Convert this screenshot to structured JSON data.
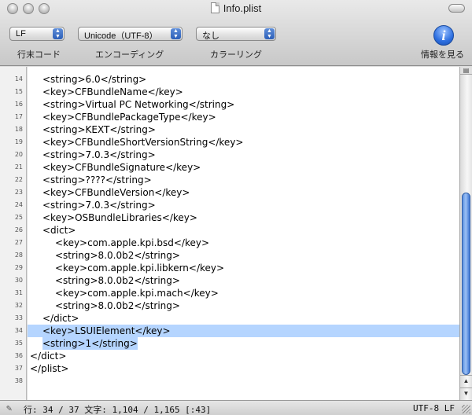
{
  "window": {
    "title": "Info.plist"
  },
  "toolbar": {
    "line_ending": {
      "value": "LF",
      "label": "行末コード"
    },
    "encoding": {
      "value": "Unicode（UTF-8）",
      "label": "エンコーディング"
    },
    "coloring": {
      "value": "なし",
      "label": "カラーリング"
    },
    "info": {
      "label": "情報を見る",
      "icon": "info-icon"
    }
  },
  "editor": {
    "lines": [
      {
        "n": "14",
        "indent": 1,
        "text": "<string>6.0</string>"
      },
      {
        "n": "15",
        "indent": 1,
        "text": "<key>CFBundleName</key>"
      },
      {
        "n": "16",
        "indent": 1,
        "text": "<string>Virtual PC Networking</string>"
      },
      {
        "n": "17",
        "indent": 1,
        "text": "<key>CFBundlePackageType</key>"
      },
      {
        "n": "18",
        "indent": 1,
        "text": "<string>KEXT</string>"
      },
      {
        "n": "19",
        "indent": 1,
        "text": "<key>CFBundleShortVersionString</key>"
      },
      {
        "n": "20",
        "indent": 1,
        "text": "<string>7.0.3</string>"
      },
      {
        "n": "21",
        "indent": 1,
        "text": "<key>CFBundleSignature</key>"
      },
      {
        "n": "22",
        "indent": 1,
        "text": "<string>????</string>"
      },
      {
        "n": "23",
        "indent": 1,
        "text": "<key>CFBundleVersion</key>"
      },
      {
        "n": "24",
        "indent": 1,
        "text": "<string>7.0.3</string>"
      },
      {
        "n": "25",
        "indent": 1,
        "text": "<key>OSBundleLibraries</key>"
      },
      {
        "n": "26",
        "indent": 1,
        "text": "<dict>"
      },
      {
        "n": "27",
        "indent": 2,
        "text": "<key>com.apple.kpi.bsd</key>"
      },
      {
        "n": "28",
        "indent": 2,
        "text": "<string>8.0.0b2</string>"
      },
      {
        "n": "29",
        "indent": 2,
        "text": "<key>com.apple.kpi.libkern</key>"
      },
      {
        "n": "30",
        "indent": 2,
        "text": "<string>8.0.0b2</string>"
      },
      {
        "n": "31",
        "indent": 2,
        "text": "<key>com.apple.kpi.mach</key>"
      },
      {
        "n": "32",
        "indent": 2,
        "text": "<string>8.0.0b2</string>"
      },
      {
        "n": "33",
        "indent": 1,
        "text": "</dict>"
      },
      {
        "n": "34",
        "indent": 1,
        "text": "<key>LSUIElement</key>",
        "selected": "full"
      },
      {
        "n": "35",
        "indent": 1,
        "text": "<string>1</string>",
        "selected": "partial"
      },
      {
        "n": "36",
        "indent": 0,
        "text": "</dict>"
      },
      {
        "n": "37",
        "indent": 0,
        "text": "</plist>"
      },
      {
        "n": "38",
        "indent": 0,
        "text": ""
      }
    ]
  },
  "status": {
    "position": "行: 34 / 37  文字: 1,104 / 1,165 [:43]",
    "encoding": "UTF-8 LF"
  },
  "colors": {
    "selection": "#b5d5ff",
    "accent": "#2d6fe0"
  }
}
